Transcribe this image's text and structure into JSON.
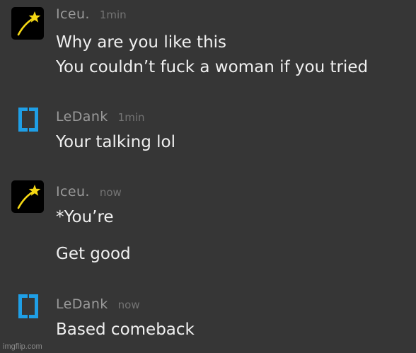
{
  "messages": [
    {
      "author": "Iceu.",
      "avatar_icon": "shooting-star-icon",
      "time": "1min",
      "lines": [
        "Why are you like this",
        "You couldn’t fuck a woman if you tried"
      ]
    },
    {
      "author": "LeDank",
      "avatar_icon": "bracket-logo-icon",
      "time": "1min",
      "lines": [
        "Your talking lol"
      ]
    },
    {
      "author": "Iceu.",
      "avatar_icon": "shooting-star-icon",
      "time": "now",
      "lines": [
        "*You’re",
        "Get good"
      ]
    },
    {
      "author": "LeDank",
      "avatar_icon": "bracket-logo-icon",
      "time": "now",
      "lines": [
        "Based comeback"
      ]
    }
  ],
  "watermark": "imgflip.com",
  "colors": {
    "background": "#363636",
    "username": "#9a9a9a",
    "timestamp": "#747474",
    "message_text": "#f0f0f0",
    "iceu_star": "#f5d814",
    "ledank_logo": "#1f9fe6"
  }
}
